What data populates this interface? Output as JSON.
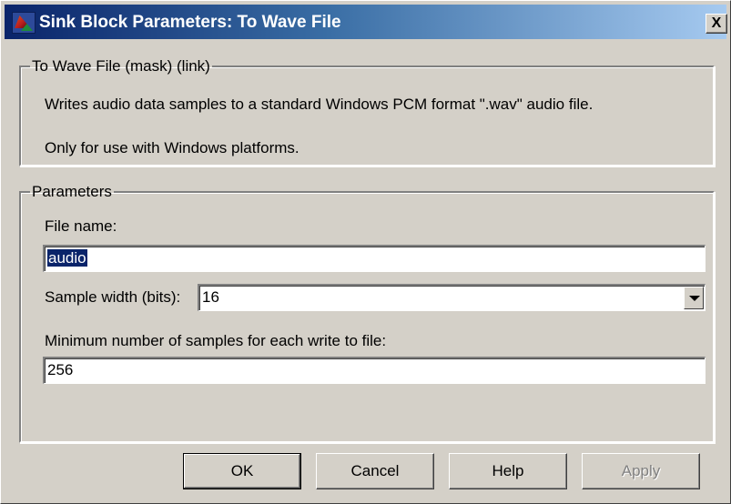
{
  "window": {
    "title": "Sink Block Parameters: To Wave File",
    "close_label": "X"
  },
  "mask_group": {
    "legend": "To Wave File (mask) (link)",
    "description_line1": "Writes audio data samples to a standard Windows PCM format \".wav\" audio file.",
    "description_line2": "Only for use with Windows platforms."
  },
  "params_group": {
    "legend": "Parameters",
    "file_name": {
      "label": "File name:",
      "value": "audio"
    },
    "sample_width": {
      "label": "Sample width (bits):",
      "value": "16"
    },
    "min_samples": {
      "label": "Minimum number of samples for each write to file:",
      "value": "256"
    }
  },
  "buttons": {
    "ok": "OK",
    "cancel": "Cancel",
    "help": "Help",
    "apply": "Apply"
  },
  "colors": {
    "title_gradient_start": "#0a246a",
    "title_gradient_end": "#a6caf0",
    "dialog_face": "#d4d0c8",
    "selection": "#0a246a"
  },
  "icons": {
    "app": "matlab-logo-icon",
    "close": "close-icon",
    "dropdown": "chevron-down-icon"
  }
}
